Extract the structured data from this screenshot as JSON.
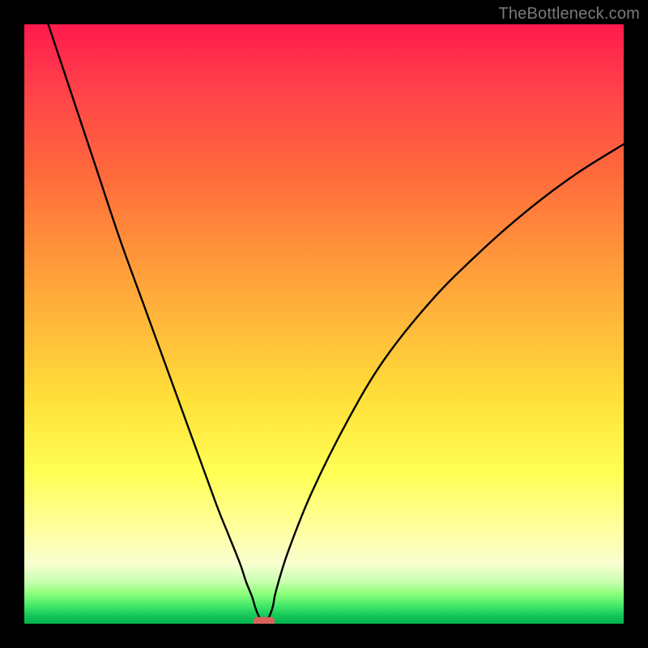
{
  "watermark": "TheBottleneck.com",
  "chart_data": {
    "type": "line",
    "title": "",
    "xlabel": "",
    "ylabel": "",
    "xlim": [
      0,
      100
    ],
    "ylim": [
      0,
      100
    ],
    "grid": false,
    "legend": false,
    "series": [
      {
        "name": "bottleneck-curve",
        "x": [
          4,
          8,
          12,
          16,
          20,
          24,
          28,
          32,
          34,
          36,
          37,
          38,
          38.5,
          39,
          39.5,
          40,
          40.5,
          41,
          41.5,
          42,
          44,
          48,
          54,
          60,
          68,
          76,
          84,
          92,
          100
        ],
        "y": [
          100,
          88,
          76,
          64,
          53,
          42,
          31,
          20,
          15,
          10,
          7,
          4.5,
          2.8,
          1.5,
          0.6,
          0.3,
          0.6,
          1.5,
          3,
          5.5,
          12,
          22,
          34,
          44,
          54,
          62,
          69,
          75,
          80
        ]
      }
    ],
    "marker": {
      "name": "optimal-point",
      "x": 40,
      "y": 0.3,
      "color": "#d9635b",
      "shape": "rounded-rect"
    },
    "background_gradient": {
      "orientation": "vertical",
      "stops": [
        {
          "pos": 0.0,
          "color": "#ff1a4d"
        },
        {
          "pos": 0.25,
          "color": "#ff6a3c"
        },
        {
          "pos": 0.5,
          "color": "#ffb93a"
        },
        {
          "pos": 0.75,
          "color": "#ffff55"
        },
        {
          "pos": 0.93,
          "color": "#c8ffb0"
        },
        {
          "pos": 1.0,
          "color": "#00b44c"
        }
      ]
    }
  }
}
